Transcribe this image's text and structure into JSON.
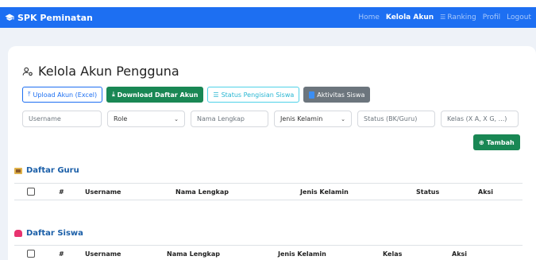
{
  "navbar": {
    "brand": "SPK Peminatan",
    "brand_icon": "graduation-cap-icon",
    "links": [
      {
        "label": "Home",
        "active": false
      },
      {
        "label": "Kelola Akun",
        "active": true
      },
      {
        "label": "Ranking",
        "active": false,
        "icon": "list-icon"
      },
      {
        "label": "Profil",
        "active": false
      },
      {
        "label": "Logout",
        "active": false
      }
    ]
  },
  "page": {
    "title": "Kelola Akun Pengguna",
    "title_icon": "users-cog-icon"
  },
  "actions": {
    "upload": "Upload Akun (Excel)",
    "download": "Download Daftar Akun",
    "status": "Status Pengisian Siswa",
    "aktivitas": "Aktivitas Siswa",
    "tambah": "Tambah"
  },
  "filters": {
    "username": "Username",
    "role": "Role",
    "nama": "Nama Lengkap",
    "jenis_kelamin": "Jenis Kelamin",
    "status": "Status (BK/Guru)",
    "kelas": "Kelas (X A, X G, ...)"
  },
  "guru": {
    "title": "Daftar Guru",
    "columns": [
      "#",
      "Username",
      "Nama Lengkap",
      "Jenis Kelamin",
      "Status",
      "Aksi"
    ]
  },
  "siswa": {
    "title": "Daftar Siswa",
    "columns": [
      "#",
      "Username",
      "Nama Lengkap",
      "Jenis Kelamin",
      "Kelas",
      "Aksi"
    ]
  },
  "colors": {
    "primary": "#1d6ff2",
    "success": "#198754",
    "info": "#28b6d2",
    "secondary": "#6c757d",
    "section_title": "#1b5fa8"
  }
}
